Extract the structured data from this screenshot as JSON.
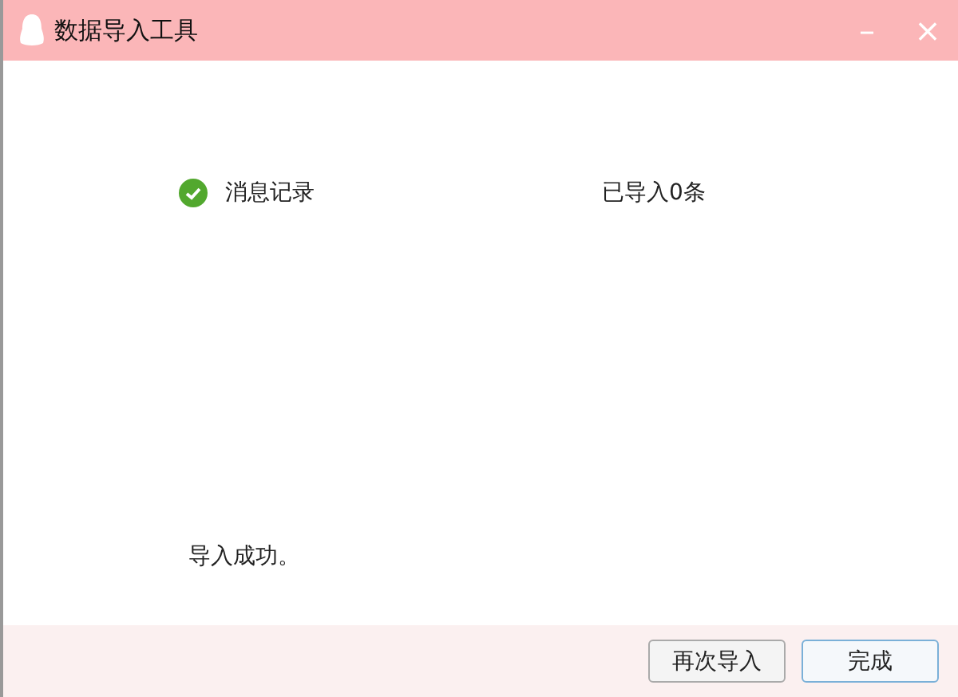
{
  "window": {
    "title": "数据导入工具",
    "controls": [
      "–",
      "×"
    ]
  },
  "items": [
    {
      "name": "消息记录",
      "done": true,
      "result": "已导入0条"
    }
  ],
  "message": "导入成功。",
  "buttons": [
    {
      "label": "再次导入",
      "default": false
    },
    {
      "label": "完成",
      "default": true
    }
  ]
}
